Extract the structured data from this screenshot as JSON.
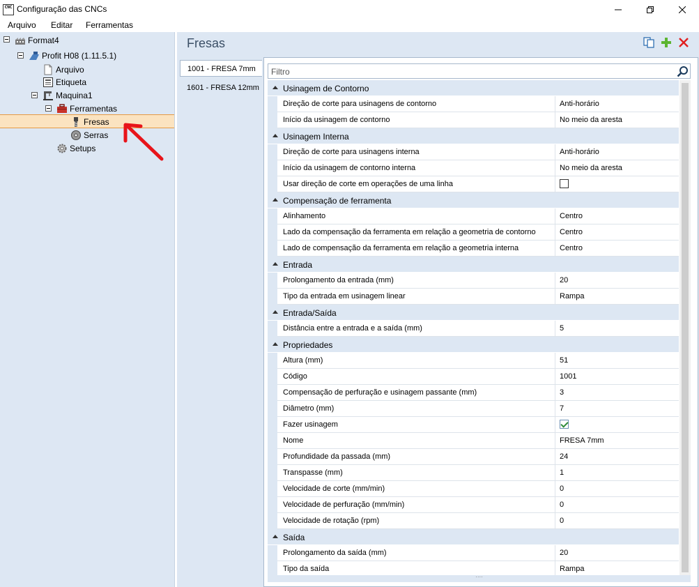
{
  "window": {
    "title": "Configuração das CNCs",
    "icon_text": "CNC"
  },
  "menu": [
    "Arquivo",
    "Editar",
    "Ferramentas"
  ],
  "tree": {
    "nodes": [
      {
        "label": "Format4",
        "icon": "building-icon"
      },
      {
        "label": "Profit H08 (1.11.5.1)",
        "icon": "machine-icon"
      },
      {
        "label": "Arquivo",
        "icon": "file-icon"
      },
      {
        "label": "Etiqueta",
        "icon": "label-icon"
      },
      {
        "label": "Maquina1",
        "icon": "cnc-icon"
      },
      {
        "label": "Ferramentas",
        "icon": "toolbox-icon"
      },
      {
        "label": "Fresas",
        "icon": "mill-icon"
      },
      {
        "label": "Serras",
        "icon": "saw-icon"
      },
      {
        "label": "Setups",
        "icon": "gear-icon"
      }
    ]
  },
  "main": {
    "title": "Fresas",
    "tools": [
      {
        "label": "1001 - FRESA 7mm"
      },
      {
        "label": "1601 - FRESA 12mm"
      }
    ],
    "filter_placeholder": "Filtro"
  },
  "properties": {
    "categories": [
      {
        "label": "Usinagem de Contorno",
        "rows": [
          {
            "name": "Direção de corte para usinagens de contorno",
            "value": "Anti-horário"
          },
          {
            "name": "Início da usinagem de contorno",
            "value": "No meio da aresta"
          }
        ]
      },
      {
        "label": "Usinagem Interna",
        "rows": [
          {
            "name": "Direção de corte para usinagens interna",
            "value": "Anti-horário"
          },
          {
            "name": "Início da usinagem de contorno interna",
            "value": "No meio da aresta"
          },
          {
            "name": "Usar direção de corte em operações de uma linha",
            "checkbox": false
          }
        ]
      },
      {
        "label": "Compensação de ferramenta",
        "rows": [
          {
            "name": "Alinhamento",
            "value": "Centro"
          },
          {
            "name": "Lado da compensação da ferramenta em relação a geometria de contorno",
            "value": "Centro"
          },
          {
            "name": "Lado de compensação da ferramenta em relação a geometria interna",
            "value": "Centro"
          }
        ]
      },
      {
        "label": "Entrada",
        "rows": [
          {
            "name": "Prolongamento da entrada (mm)",
            "value": "20"
          },
          {
            "name": "Tipo da entrada em usinagem linear",
            "value": "Rampa"
          }
        ]
      },
      {
        "label": "Entrada/Saída",
        "rows": [
          {
            "name": "Distância entre a entrada e a saída (mm)",
            "value": "5"
          }
        ]
      },
      {
        "label": "Propriedades",
        "rows": [
          {
            "name": "Altura (mm)",
            "value": "51"
          },
          {
            "name": "Código",
            "value": "1001"
          },
          {
            "name": "Compensação de perfuração e usinagem passante (mm)",
            "value": "3"
          },
          {
            "name": "Diâmetro (mm)",
            "value": "7"
          },
          {
            "name": "Fazer usinagem",
            "checkbox": true
          },
          {
            "name": "Nome",
            "value": "FRESA 7mm"
          },
          {
            "name": "Profundidade da passada (mm)",
            "value": "24"
          },
          {
            "name": "Transpasse (mm)",
            "value": "1"
          },
          {
            "name": "Velocidade de corte (mm/min)",
            "value": "0"
          },
          {
            "name": "Velocidade de perfuração (mm/min)",
            "value": "0"
          },
          {
            "name": "Velocidade de rotação (rpm)",
            "value": "0"
          }
        ]
      },
      {
        "label": "Saída",
        "rows": [
          {
            "name": "Prolongamento da saída (mm)",
            "value": "20"
          },
          {
            "name": "Tipo da saída",
            "value": "Rampa"
          }
        ]
      }
    ]
  },
  "colors": {
    "pane_bg": "#dde7f3",
    "selection": "#fbe3c0",
    "selection_border": "#e59a43",
    "annotation_arrow": "#e8141a"
  }
}
